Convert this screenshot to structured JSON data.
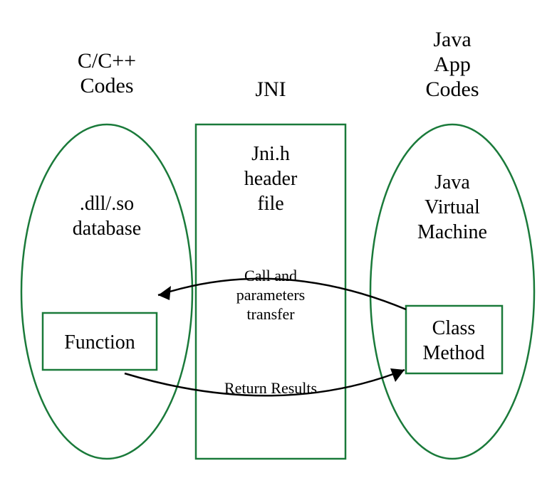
{
  "left": {
    "title_line1": "C/C++",
    "title_line2": "Codes",
    "body_line1": ".dll/.so",
    "body_line2": "database",
    "box_label": "Function"
  },
  "center": {
    "title": "JNI",
    "header_line1": "Jni.h",
    "header_line2": "header",
    "header_line3": "file",
    "arrow_top_line1": "Call and",
    "arrow_top_line2": "parameters",
    "arrow_top_line3": "transfer",
    "arrow_bottom": "Return Results"
  },
  "right": {
    "title_line1": "Java",
    "title_line2": "App",
    "title_line3": "Codes",
    "body_line1": "Java",
    "body_line2": "Virtual",
    "body_line3": "Machine",
    "box_line1": "Class",
    "box_line2": "Method"
  },
  "colors": {
    "stroke": "#1a7a3a",
    "arrow": "#000000"
  }
}
